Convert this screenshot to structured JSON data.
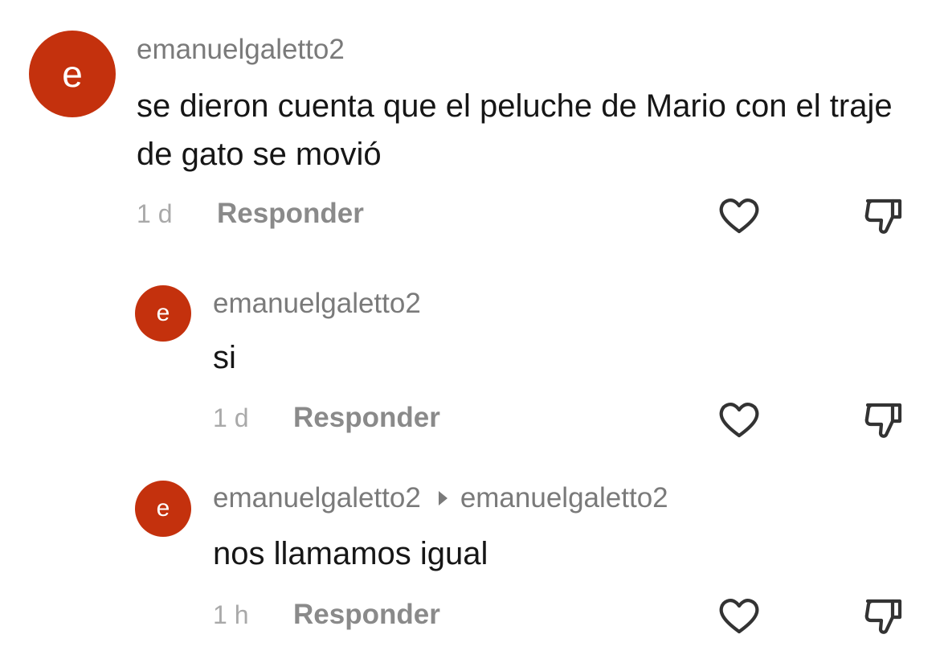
{
  "comments": [
    {
      "avatar_letter": "e",
      "username": "emanuelgaletto2",
      "text": "se dieron cuenta que el peluche de Mario con el traje de gato se movió",
      "time": "1 d",
      "reply_label": "Responder"
    },
    {
      "avatar_letter": "e",
      "username": "emanuelgaletto2",
      "text": "si",
      "time": "1 d",
      "reply_label": "Responder"
    },
    {
      "avatar_letter": "e",
      "username": "emanuelgaletto2",
      "reply_to": "emanuelgaletto2",
      "text": "nos llamamos igual",
      "time": "1 h",
      "reply_label": "Responder"
    }
  ],
  "icons": {
    "like": "heart-outline-icon",
    "dislike": "thumbs-down-outline-icon",
    "reply_indicator": "right-caret-icon"
  },
  "colors": {
    "avatar": "#c4310d",
    "username": "#7a7a7a",
    "text": "#161616",
    "time": "#a9a9a9",
    "reply": "#8a8a8a"
  }
}
